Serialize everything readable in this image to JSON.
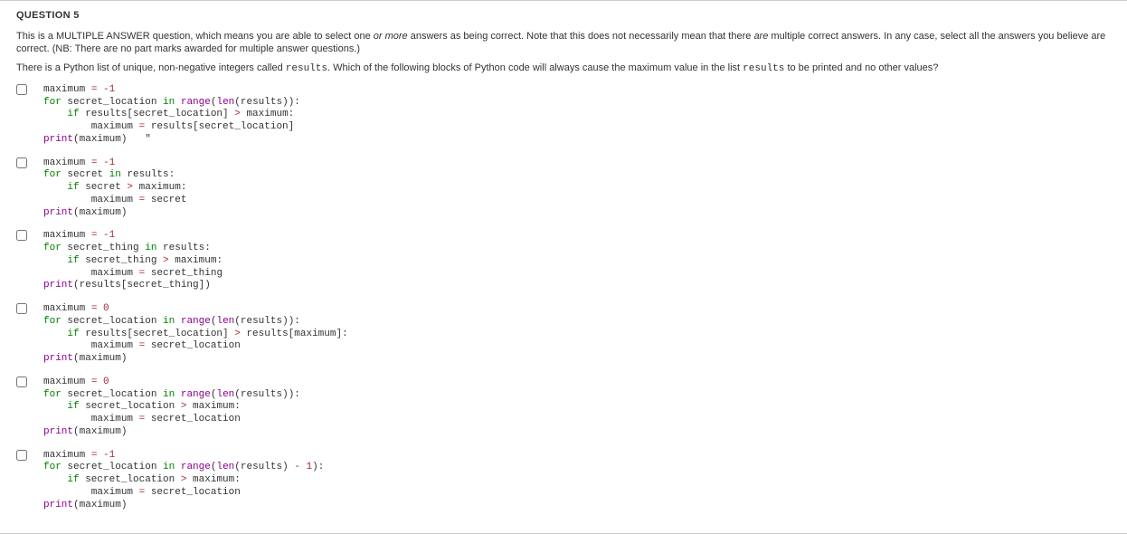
{
  "question_title": "QUESTION 5",
  "intro_part1": "This is a MULTIPLE ANSWER question, which means you are able to select one ",
  "intro_em1": "or more",
  "intro_part2": " answers as being correct.  Note that this does not necessarily mean that there ",
  "intro_em2": "are",
  "intro_part3": " multiple correct answers.  In any case, select all the answers you believe are correct.  (NB: There are no part marks awarded for multiple answer questions.)",
  "prompt_part1": "There is a Python list of unique, non-negative integers called ",
  "prompt_code1": "results",
  "prompt_part2": ".  Which of the following blocks of Python code will always cause the maximum value in the list ",
  "prompt_code2": "results",
  "prompt_part3": " to be printed and no other values?",
  "options": [
    {
      "lines": [
        [
          [
            "def",
            "maximum "
          ],
          [
            "op",
            "="
          ],
          [
            "def",
            " "
          ],
          [
            "op",
            "-"
          ],
          [
            "num",
            "1"
          ]
        ],
        [
          [
            "kw",
            "for"
          ],
          [
            "def",
            " secret_location "
          ],
          [
            "kw",
            "in"
          ],
          [
            "def",
            " "
          ],
          [
            "func",
            "range"
          ],
          [
            "def",
            "("
          ],
          [
            "func",
            "len"
          ],
          [
            "def",
            "(results)):"
          ]
        ],
        [
          [
            "def",
            "    "
          ],
          [
            "kw",
            "if"
          ],
          [
            "def",
            " results[secret_location] "
          ],
          [
            "op",
            ">"
          ],
          [
            "def",
            " maximum:"
          ]
        ],
        [
          [
            "def",
            "        maximum "
          ],
          [
            "op",
            "="
          ],
          [
            "def",
            " results[secret_location]"
          ]
        ],
        [
          [
            "func",
            "print"
          ],
          [
            "def",
            "(maximum)   \""
          ]
        ]
      ]
    },
    {
      "lines": [
        [
          [
            "def",
            "maximum "
          ],
          [
            "op",
            "="
          ],
          [
            "def",
            " "
          ],
          [
            "op",
            "-"
          ],
          [
            "num",
            "1"
          ]
        ],
        [
          [
            "kw",
            "for"
          ],
          [
            "def",
            " secret "
          ],
          [
            "kw",
            "in"
          ],
          [
            "def",
            " results:"
          ]
        ],
        [
          [
            "def",
            "    "
          ],
          [
            "kw",
            "if"
          ],
          [
            "def",
            " secret "
          ],
          [
            "op",
            ">"
          ],
          [
            "def",
            " maximum:"
          ]
        ],
        [
          [
            "def",
            "        maximum "
          ],
          [
            "op",
            "="
          ],
          [
            "def",
            " secret"
          ]
        ],
        [
          [
            "func",
            "print"
          ],
          [
            "def",
            "(maximum)"
          ]
        ]
      ]
    },
    {
      "lines": [
        [
          [
            "def",
            "maximum "
          ],
          [
            "op",
            "="
          ],
          [
            "def",
            " "
          ],
          [
            "op",
            "-"
          ],
          [
            "num",
            "1"
          ]
        ],
        [
          [
            "kw",
            "for"
          ],
          [
            "def",
            " secret_thing "
          ],
          [
            "kw",
            "in"
          ],
          [
            "def",
            " results:"
          ]
        ],
        [
          [
            "def",
            "    "
          ],
          [
            "kw",
            "if"
          ],
          [
            "def",
            " secret_thing "
          ],
          [
            "op",
            ">"
          ],
          [
            "def",
            " maximum:"
          ]
        ],
        [
          [
            "def",
            "        maximum "
          ],
          [
            "op",
            "="
          ],
          [
            "def",
            " secret_thing"
          ]
        ],
        [
          [
            "func",
            "print"
          ],
          [
            "def",
            "(results[secret_thing])"
          ]
        ]
      ]
    },
    {
      "lines": [
        [
          [
            "def",
            "maximum "
          ],
          [
            "op",
            "="
          ],
          [
            "def",
            " "
          ],
          [
            "num",
            "0"
          ]
        ],
        [
          [
            "kw",
            "for"
          ],
          [
            "def",
            " secret_location "
          ],
          [
            "kw",
            "in"
          ],
          [
            "def",
            " "
          ],
          [
            "func",
            "range"
          ],
          [
            "def",
            "("
          ],
          [
            "func",
            "len"
          ],
          [
            "def",
            "(results)):"
          ]
        ],
        [
          [
            "def",
            "    "
          ],
          [
            "kw",
            "if"
          ],
          [
            "def",
            " results[secret_location] "
          ],
          [
            "op",
            ">"
          ],
          [
            "def",
            " results[maximum]:"
          ]
        ],
        [
          [
            "def",
            "        maximum "
          ],
          [
            "op",
            "="
          ],
          [
            "def",
            " secret_location"
          ]
        ],
        [
          [
            "func",
            "print"
          ],
          [
            "def",
            "(maximum)"
          ]
        ]
      ]
    },
    {
      "lines": [
        [
          [
            "def",
            "maximum "
          ],
          [
            "op",
            "="
          ],
          [
            "def",
            " "
          ],
          [
            "num",
            "0"
          ]
        ],
        [
          [
            "kw",
            "for"
          ],
          [
            "def",
            " secret_location "
          ],
          [
            "kw",
            "in"
          ],
          [
            "def",
            " "
          ],
          [
            "func",
            "range"
          ],
          [
            "def",
            "("
          ],
          [
            "func",
            "len"
          ],
          [
            "def",
            "(results)):"
          ]
        ],
        [
          [
            "def",
            "    "
          ],
          [
            "kw",
            "if"
          ],
          [
            "def",
            " secret_location "
          ],
          [
            "op",
            ">"
          ],
          [
            "def",
            " maximum:"
          ]
        ],
        [
          [
            "def",
            "        maximum "
          ],
          [
            "op",
            "="
          ],
          [
            "def",
            " secret_location"
          ]
        ],
        [
          [
            "func",
            "print"
          ],
          [
            "def",
            "(maximum)"
          ]
        ]
      ]
    },
    {
      "lines": [
        [
          [
            "def",
            "maximum "
          ],
          [
            "op",
            "="
          ],
          [
            "def",
            " "
          ],
          [
            "op",
            "-"
          ],
          [
            "num",
            "1"
          ]
        ],
        [
          [
            "kw",
            "for"
          ],
          [
            "def",
            " secret_location "
          ],
          [
            "kw",
            "in"
          ],
          [
            "def",
            " "
          ],
          [
            "func",
            "range"
          ],
          [
            "def",
            "("
          ],
          [
            "func",
            "len"
          ],
          [
            "def",
            "(results) "
          ],
          [
            "op",
            "-"
          ],
          [
            "def",
            " "
          ],
          [
            "num",
            "1"
          ],
          [
            "def",
            "):"
          ]
        ],
        [
          [
            "def",
            "    "
          ],
          [
            "kw",
            "if"
          ],
          [
            "def",
            " secret_location "
          ],
          [
            "op",
            ">"
          ],
          [
            "def",
            " maximum:"
          ]
        ],
        [
          [
            "def",
            "        maximum "
          ],
          [
            "op",
            "="
          ],
          [
            "def",
            " secret_location"
          ]
        ],
        [
          [
            "func",
            "print"
          ],
          [
            "def",
            "(maximum)"
          ]
        ]
      ]
    }
  ]
}
